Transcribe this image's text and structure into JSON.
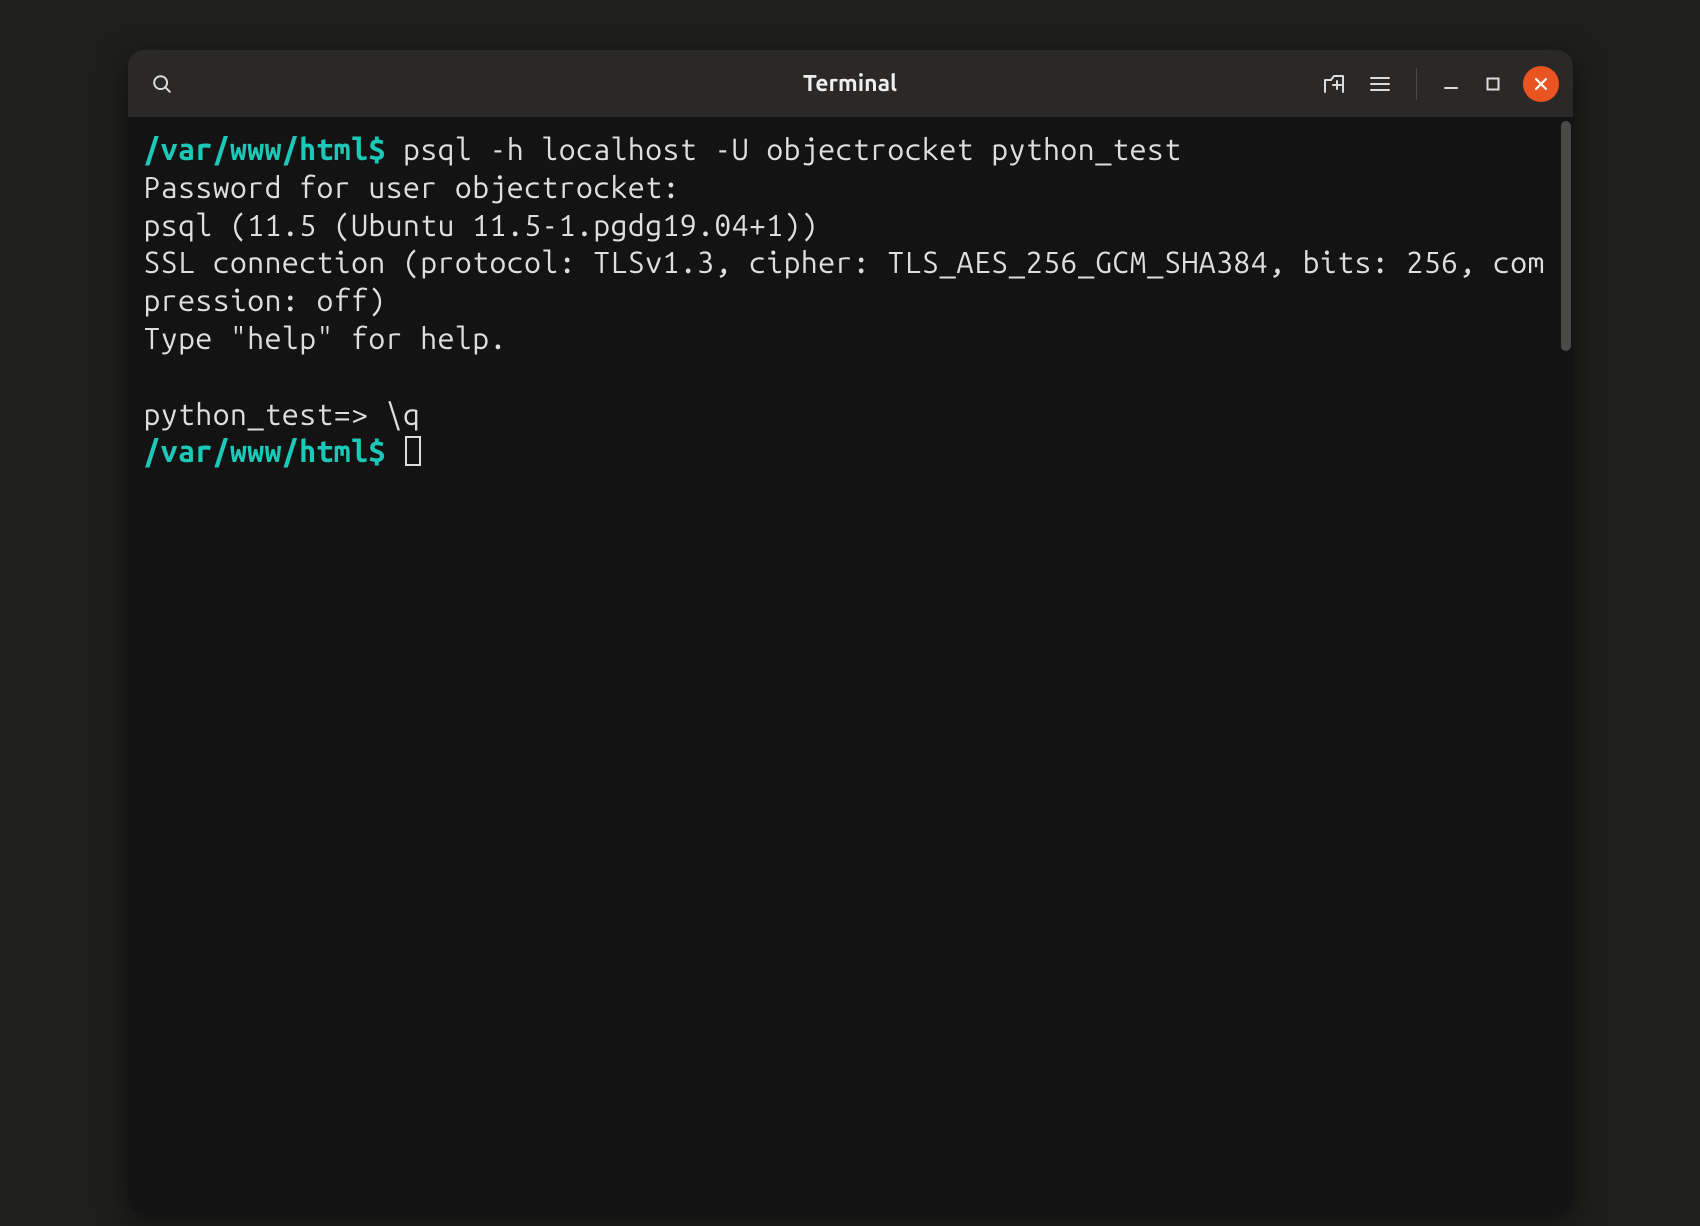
{
  "window": {
    "title": "Terminal"
  },
  "colors": {
    "prompt": "#1cc9b8",
    "close_bg": "#e95420"
  },
  "terminal": {
    "lines": [
      {
        "type": "prompt",
        "path": "/var/www/html",
        "symbol": "$",
        "command": "psql -h localhost -U objectrocket python_test"
      },
      {
        "type": "output",
        "text": "Password for user objectrocket:"
      },
      {
        "type": "output",
        "text": "psql (11.5 (Ubuntu 11.5-1.pgdg19.04+1))"
      },
      {
        "type": "output",
        "text": "SSL connection (protocol: TLSv1.3, cipher: TLS_AES_256_GCM_SHA384, bits: 256, compression: off)"
      },
      {
        "type": "output",
        "text": "Type \"help\" for help."
      },
      {
        "type": "blank",
        "text": ""
      },
      {
        "type": "psql-prompt",
        "prompt": "python_test=>",
        "command": "\\q"
      },
      {
        "type": "prompt-cursor",
        "path": "/var/www/html",
        "symbol": "$"
      }
    ]
  }
}
